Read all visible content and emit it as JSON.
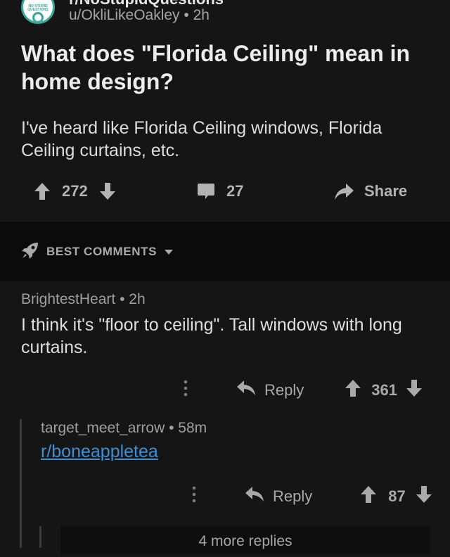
{
  "post": {
    "subreddit": "r/NoStupidQuestions",
    "avatar_text": "NO STUPID QUESTIONS",
    "author": "u/OkliLikeOakley",
    "age": "2h",
    "title": "What does \"Florida Ceiling\" mean in home design?",
    "body": "I've heard like Florida Ceiling windows, Florida Ceiling curtains, etc.",
    "upvotes": "272",
    "comments": "27",
    "share_label": "Share"
  },
  "sort": {
    "label": "BEST COMMENTS"
  },
  "comments": [
    {
      "author": "BrightestHeart",
      "age": "2h",
      "body": "I think it's \"floor to ceiling\". Tall windows with long curtains.",
      "reply_label": "Reply",
      "score": "361"
    },
    {
      "author": "target_meet_arrow",
      "age": "58m",
      "body": "r/boneappletea",
      "reply_label": "Reply",
      "score": "87"
    }
  ],
  "more_replies": "4 more replies",
  "colors": {
    "background": "#151515",
    "band": "#0b0b0b",
    "link": "#3d8fd6",
    "avatar_accent": "#37a89a"
  }
}
